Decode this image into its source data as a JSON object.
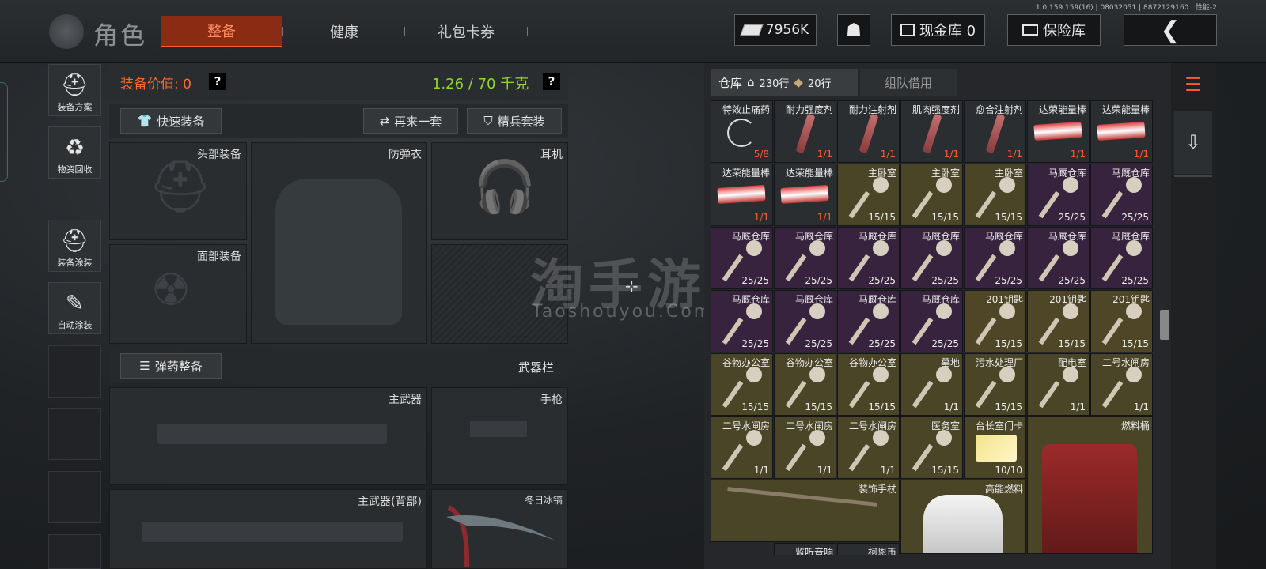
{
  "version_text": "1.0.159.159(16) | 08032051 | 8872129160 | 性能-2",
  "header": {
    "title": "角色",
    "tabs": [
      {
        "label": "整备",
        "active": true
      },
      {
        "label": "健康",
        "active": false
      },
      {
        "label": "礼包卡券",
        "active": false
      }
    ],
    "currency": "7956K",
    "cash_vault": "现金库 0",
    "safe_label": "保险库",
    "back_icon": "chevron-left-icon"
  },
  "sidebar": [
    {
      "label": "装备方案",
      "icon": "helmet-plan-icon"
    },
    {
      "label": "物资回收",
      "icon": "recycle-icon"
    },
    {
      "label": "装备涂装",
      "icon": "paint-helmet-icon"
    },
    {
      "label": "自动涂装",
      "icon": "auto-paint-icon"
    }
  ],
  "loadout": {
    "value_label": "装备价值: 0",
    "weight_label": "1.26 / 70 千克",
    "quick_equip": "快速装备",
    "again": "再来一套",
    "elite": "精兵套装",
    "head": "头部装备",
    "armor": "防弹衣",
    "headset": "耳机",
    "face": "面部装备",
    "ammo_btn": "弹药整备",
    "weapon_bar": "武器栏",
    "primary": "主武器",
    "pistol": "手枪",
    "primary_back": "主武器(背部)",
    "melee": "冬日冰镐"
  },
  "warehouse": {
    "tab_label": "仓库",
    "rows_home": "230行",
    "rows_extra": "20行",
    "team_tab": "组队借用",
    "items": [
      {
        "name": "特效止痛药",
        "count": "5/8",
        "red": true,
        "color": "dark",
        "icon": "pill-icon"
      },
      {
        "name": "耐力强度剂",
        "count": "1/1",
        "red": true,
        "color": "dark",
        "icon": "syringe-icon"
      },
      {
        "name": "耐力注射剂",
        "count": "1/1",
        "red": true,
        "color": "dark",
        "icon": "syringe-icon"
      },
      {
        "name": "肌肉强度剂",
        "count": "1/1",
        "red": true,
        "color": "dark",
        "icon": "syringe-icon"
      },
      {
        "name": "愈合注射剂",
        "count": "1/1",
        "red": true,
        "color": "dark",
        "icon": "syringe-icon"
      },
      {
        "name": "达荣能量棒",
        "count": "1/1",
        "red": true,
        "color": "dark",
        "icon": "bar-icon"
      },
      {
        "name": "达荣能量棒",
        "count": "1/1",
        "red": true,
        "color": "dark",
        "icon": "bar-icon"
      },
      {
        "name": "达荣能量棒",
        "count": "1/1",
        "red": true,
        "color": "dark",
        "icon": "bar-icon"
      },
      {
        "name": "达荣能量棒",
        "count": "1/1",
        "red": true,
        "color": "dark",
        "icon": "bar-icon"
      },
      {
        "name": "主卧室",
        "count": "15/15",
        "red": false,
        "color": "olive",
        "icon": "key-icon"
      },
      {
        "name": "主卧室",
        "count": "15/15",
        "red": false,
        "color": "olive",
        "icon": "key-icon"
      },
      {
        "name": "主卧室",
        "count": "15/15",
        "red": false,
        "color": "olive",
        "icon": "key-icon"
      },
      {
        "name": "马厩仓库",
        "count": "25/25",
        "red": false,
        "color": "purple",
        "icon": "key-icon"
      },
      {
        "name": "马厩仓库",
        "count": "25/25",
        "red": false,
        "color": "purple",
        "icon": "key-icon"
      },
      {
        "name": "马厩仓库",
        "count": "25/25",
        "red": false,
        "color": "purple",
        "icon": "key-icon"
      },
      {
        "name": "马厩仓库",
        "count": "25/25",
        "red": false,
        "color": "purple",
        "icon": "key-icon"
      },
      {
        "name": "马厩仓库",
        "count": "25/25",
        "red": false,
        "color": "purple",
        "icon": "key-icon"
      },
      {
        "name": "马厩仓库",
        "count": "25/25",
        "red": false,
        "color": "purple",
        "icon": "key-icon"
      },
      {
        "name": "马厩仓库",
        "count": "25/25",
        "red": false,
        "color": "purple",
        "icon": "key-icon"
      },
      {
        "name": "马厩仓库",
        "count": "25/25",
        "red": false,
        "color": "purple",
        "icon": "key-icon"
      },
      {
        "name": "马厩仓库",
        "count": "25/25",
        "red": false,
        "color": "purple",
        "icon": "key-icon"
      },
      {
        "name": "马厩仓库",
        "count": "25/25",
        "red": false,
        "color": "purple",
        "icon": "key-icon"
      },
      {
        "name": "马厩仓库",
        "count": "25/25",
        "red": false,
        "color": "purple",
        "icon": "key-icon"
      },
      {
        "name": "马厩仓库",
        "count": "25/25",
        "red": false,
        "color": "purple",
        "icon": "key-icon"
      },
      {
        "name": "马厩仓库",
        "count": "25/25",
        "red": false,
        "color": "purple",
        "icon": "key-icon"
      },
      {
        "name": "201钥匙",
        "count": "15/15",
        "red": false,
        "color": "gold",
        "icon": "key-icon"
      },
      {
        "name": "201钥匙",
        "count": "15/15",
        "red": false,
        "color": "gold",
        "icon": "key-icon"
      },
      {
        "name": "201钥匙",
        "count": "15/15",
        "red": false,
        "color": "gold",
        "icon": "key-icon"
      },
      {
        "name": "谷物办公室",
        "count": "15/15",
        "red": false,
        "color": "olive",
        "icon": "key-icon"
      },
      {
        "name": "谷物办公室",
        "count": "15/15",
        "red": false,
        "color": "olive",
        "icon": "key-icon"
      },
      {
        "name": "谷物办公室",
        "count": "15/15",
        "red": false,
        "color": "olive",
        "icon": "key-icon"
      },
      {
        "name": "墓地",
        "count": "1/1",
        "red": false,
        "color": "olive",
        "icon": "key-icon"
      },
      {
        "name": "污水处理厂",
        "count": "15/15",
        "red": false,
        "color": "olive",
        "icon": "key-icon"
      },
      {
        "name": "配电室",
        "count": "1/1",
        "red": false,
        "color": "olive",
        "icon": "key-icon"
      },
      {
        "name": "二号水闸房",
        "count": "1/1",
        "red": false,
        "color": "olive",
        "icon": "key-icon"
      },
      {
        "name": "二号水闸房",
        "count": "1/1",
        "red": false,
        "color": "olive",
        "icon": "key-icon"
      },
      {
        "name": "二号水闸房",
        "count": "1/1",
        "red": false,
        "color": "olive",
        "icon": "key-icon"
      },
      {
        "name": "二号水闸房",
        "count": "1/1",
        "red": false,
        "color": "olive",
        "icon": "key-icon"
      },
      {
        "name": "医务室",
        "count": "15/15",
        "red": false,
        "color": "olive",
        "icon": "key-icon"
      },
      {
        "name": "台长室门卡",
        "count": "10/10",
        "red": false,
        "color": "olive",
        "icon": "keycard-icon"
      }
    ],
    "big_items": [
      {
        "name": "燃料桶",
        "icon": "jerrycan-icon"
      },
      {
        "name": "装饰手杖",
        "icon": "cane-icon"
      },
      {
        "name": "高能燃料",
        "icon": "fuel-canister-icon"
      },
      {
        "name": "监听音响",
        "icon": "speaker-icon"
      },
      {
        "name": "柯恩币",
        "icon": "coin-icon"
      }
    ]
  },
  "watermark": {
    "cn": "淘手游",
    "en": "Taoshouyou.Com"
  }
}
